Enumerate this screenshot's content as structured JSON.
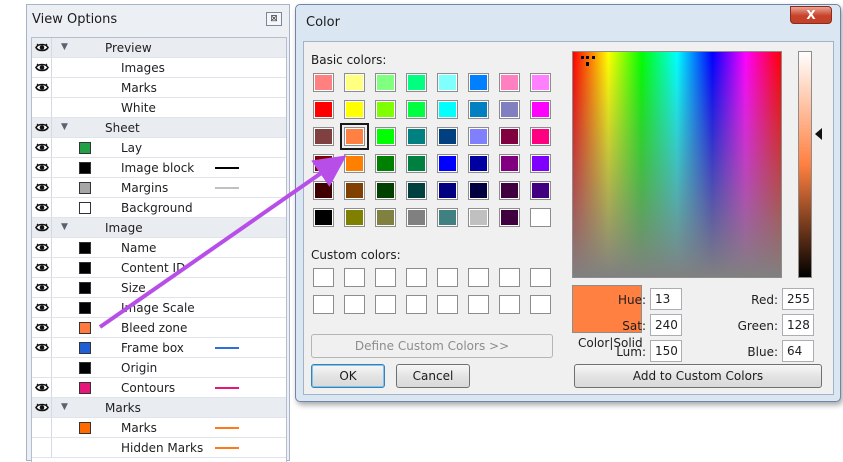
{
  "view_options": {
    "title": "View Options",
    "close_label": "⊠",
    "rows": [
      {
        "eye": true,
        "kind": "group",
        "label": "Preview"
      },
      {
        "eye": true,
        "kind": "item",
        "label": "Images"
      },
      {
        "eye": true,
        "kind": "item",
        "label": "Marks"
      },
      {
        "eye": false,
        "kind": "item",
        "label": "White"
      },
      {
        "eye": true,
        "kind": "group",
        "label": "Sheet"
      },
      {
        "eye": true,
        "kind": "item",
        "label": "Lay",
        "swatch": "#22a046"
      },
      {
        "eye": true,
        "kind": "item",
        "label": "Image block",
        "swatch": "#000000",
        "line": "#000000"
      },
      {
        "eye": true,
        "kind": "item",
        "label": "Margins",
        "swatch": "#a6a6a6",
        "line": "#c0c0c0"
      },
      {
        "eye": true,
        "kind": "item",
        "label": "Background",
        "swatch": "#ffffff"
      },
      {
        "eye": true,
        "kind": "group",
        "label": "Image"
      },
      {
        "eye": true,
        "kind": "item",
        "label": "Name",
        "swatch": "#000000"
      },
      {
        "eye": true,
        "kind": "item",
        "label": "Content ID",
        "swatch": "#000000"
      },
      {
        "eye": true,
        "kind": "item",
        "label": "Size",
        "swatch": "#000000"
      },
      {
        "eye": true,
        "kind": "item",
        "label": "Image Scale",
        "swatch": "#000000"
      },
      {
        "eye": true,
        "kind": "item",
        "label": "Bleed zone",
        "swatch": "#ff7a3c"
      },
      {
        "eye": true,
        "kind": "item",
        "label": "Frame box",
        "swatch": "#1f5fd6",
        "line": "#2e6fe0"
      },
      {
        "eye": false,
        "kind": "item",
        "label": "Origin",
        "swatch": "#000000"
      },
      {
        "eye": true,
        "kind": "item",
        "label": "Contours",
        "swatch": "#e8157a",
        "line": "#e8157a"
      },
      {
        "eye": true,
        "kind": "group",
        "label": "Marks"
      },
      {
        "eye": false,
        "kind": "item",
        "label": "Marks",
        "swatch": "#ff6a00",
        "line": "#ff7a1a"
      },
      {
        "eye": false,
        "kind": "item",
        "label": "Hidden Marks",
        "line": "#ff7a1a"
      }
    ]
  },
  "color_dialog": {
    "title": "Color",
    "close_label": "X",
    "basic_colors_label": "Basic colors:",
    "basic_colors": [
      [
        "#ff8080",
        "#ffff80",
        "#80ff80",
        "#00ff80",
        "#80ffff",
        "#0080ff",
        "#ff80c0",
        "#ff80ff"
      ],
      [
        "#ff0000",
        "#ffff00",
        "#80ff00",
        "#00ff40",
        "#00ffff",
        "#0080c0",
        "#8080c0",
        "#ff00ff"
      ],
      [
        "#804040",
        "#ff8040",
        "#00ff00",
        "#008080",
        "#004080",
        "#8080ff",
        "#800040",
        "#ff0080"
      ],
      [
        "#800000",
        "#ff8000",
        "#008000",
        "#008040",
        "#0000ff",
        "#0000a0",
        "#800080",
        "#8000ff"
      ],
      [
        "#400000",
        "#804000",
        "#004000",
        "#004040",
        "#000080",
        "#000040",
        "#400040",
        "#400080"
      ],
      [
        "#000000",
        "#808000",
        "#808040",
        "#808080",
        "#408080",
        "#c0c0c0",
        "#400040",
        "#ffffff"
      ]
    ],
    "selected_basic": [
      2,
      1
    ],
    "custom_colors_label": "Custom colors:",
    "define_custom_label": "Define Custom Colors >>",
    "ok_label": "OK",
    "cancel_label": "Cancel",
    "preview_label": "Color|Solid",
    "preview_color": "#ff8040",
    "hue_label": "Hue:",
    "hue": "13",
    "sat_label": "Sat:",
    "sat": "240",
    "lum_label": "Lum:",
    "lum": "150",
    "red_label": "Red:",
    "red": "255",
    "green_label": "Green:",
    "green": "128",
    "blue_label": "Blue:",
    "blue": "64",
    "add_custom_label": "Add to Custom Colors"
  },
  "annotation_arrow_color": "#b74ee8"
}
